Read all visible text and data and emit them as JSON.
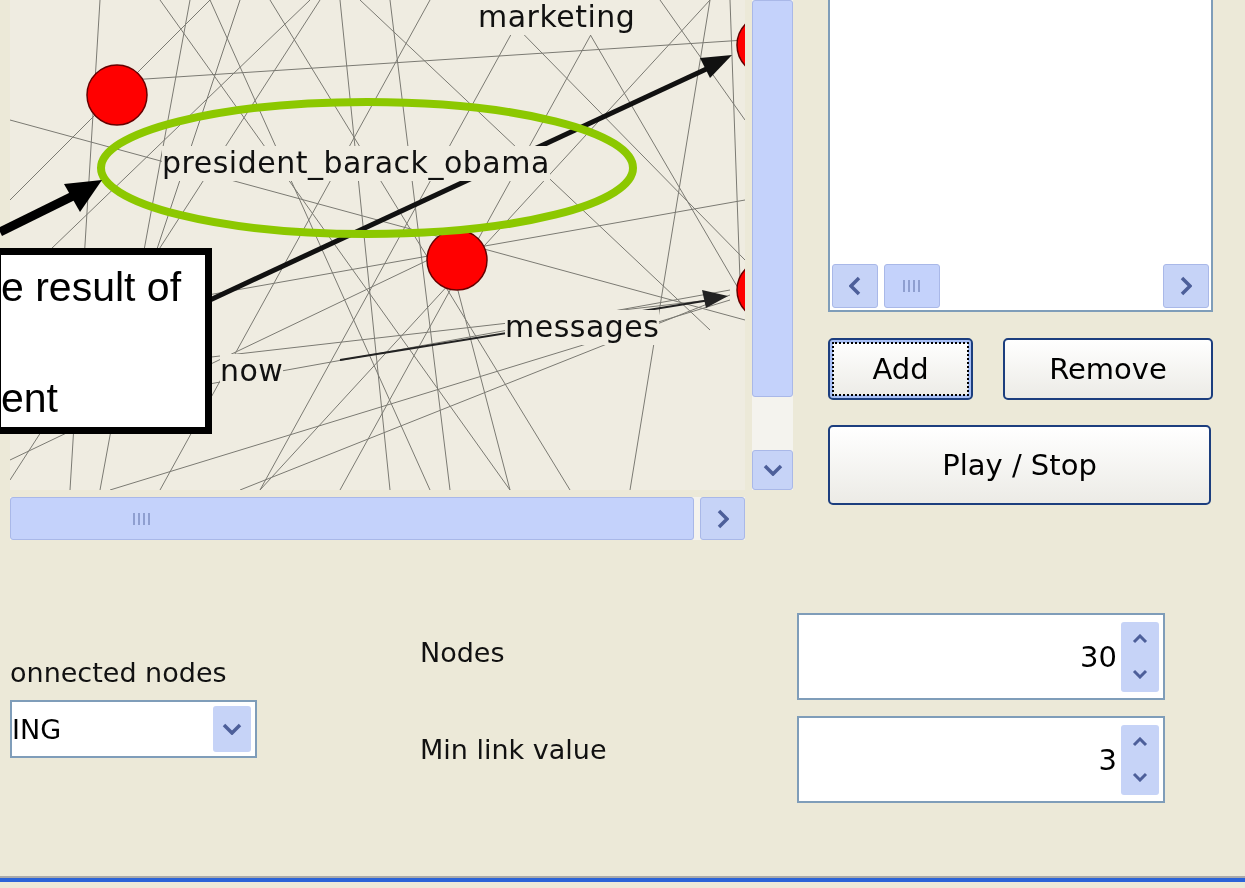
{
  "graph": {
    "labels": [
      {
        "text": "marketing"
      },
      {
        "text": "president_barack_obama"
      },
      {
        "text": "messages"
      },
      {
        "text": "now"
      }
    ]
  },
  "annotation": {
    "lines": [
      "e result of",
      "ent"
    ]
  },
  "right_panel": {
    "buttons": [
      {
        "label": "Add",
        "focused": true
      },
      {
        "label": "Remove",
        "focused": false
      }
    ],
    "play_button": "Play / Stop"
  },
  "settings": {
    "partial_label": "onnected nodes",
    "combo_value": "ING",
    "spinners": [
      {
        "label": "Nodes",
        "value": "30"
      },
      {
        "label": "Min link value",
        "value": "3"
      }
    ]
  }
}
